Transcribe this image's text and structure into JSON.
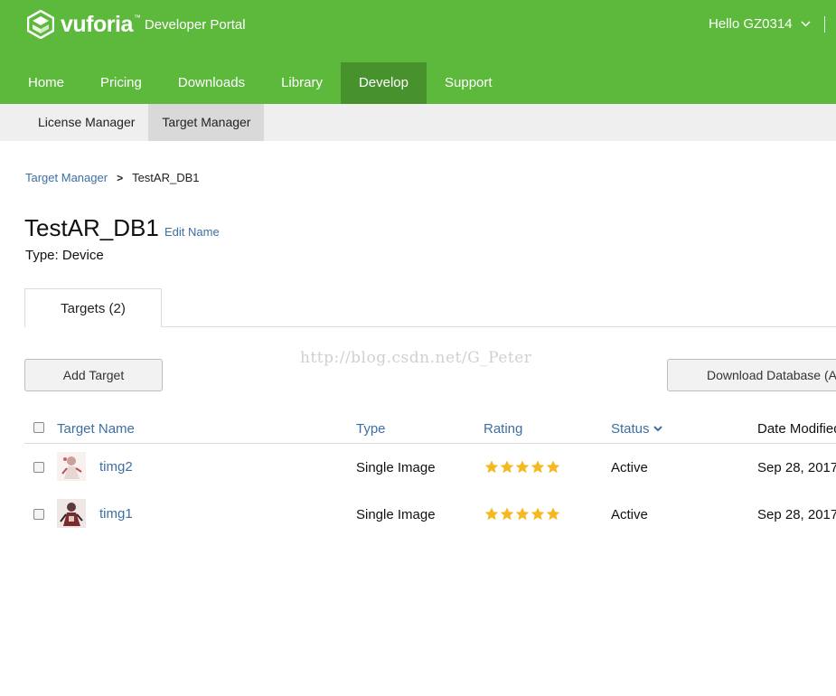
{
  "header": {
    "logo_word": "vuforia",
    "logo_tm": "™",
    "logo_portal": "Developer Portal",
    "greeting": "Hello GZ0314"
  },
  "nav": {
    "items": [
      {
        "label": "Home",
        "active": false
      },
      {
        "label": "Pricing",
        "active": false
      },
      {
        "label": "Downloads",
        "active": false
      },
      {
        "label": "Library",
        "active": false
      },
      {
        "label": "Develop",
        "active": true
      },
      {
        "label": "Support",
        "active": false
      }
    ]
  },
  "subnav": {
    "items": [
      {
        "label": "License Manager",
        "active": false
      },
      {
        "label": "Target Manager",
        "active": true
      }
    ]
  },
  "breadcrumb": {
    "parent": "Target Manager",
    "separator": ">",
    "current": "TestAR_DB1"
  },
  "database": {
    "name": "TestAR_DB1",
    "edit_label": "Edit Name",
    "type_label": "Type:",
    "type_value": "Device"
  },
  "tabs": {
    "targets": "Targets (2)"
  },
  "watermark": "http://blog.csdn.net/G_Peter",
  "buttons": {
    "add_target": "Add Target",
    "download_database": "Download Database (All)"
  },
  "table": {
    "headers": {
      "name": "Target Name",
      "type": "Type",
      "rating": "Rating",
      "status": "Status",
      "date": "Date Modified"
    },
    "rows": [
      {
        "name": "timg2",
        "type": "Single Image",
        "rating": 5,
        "status": "Active",
        "date": "Sep 28, 2017"
      },
      {
        "name": "timg1",
        "type": "Single Image",
        "rating": 5,
        "status": "Active",
        "date": "Sep 28, 2017"
      }
    ]
  },
  "colors": {
    "brand_green": "#5cb93c",
    "active_nav": "#48922e",
    "link_blue": "#3d6fa3",
    "star_yellow": "#f5b820"
  }
}
